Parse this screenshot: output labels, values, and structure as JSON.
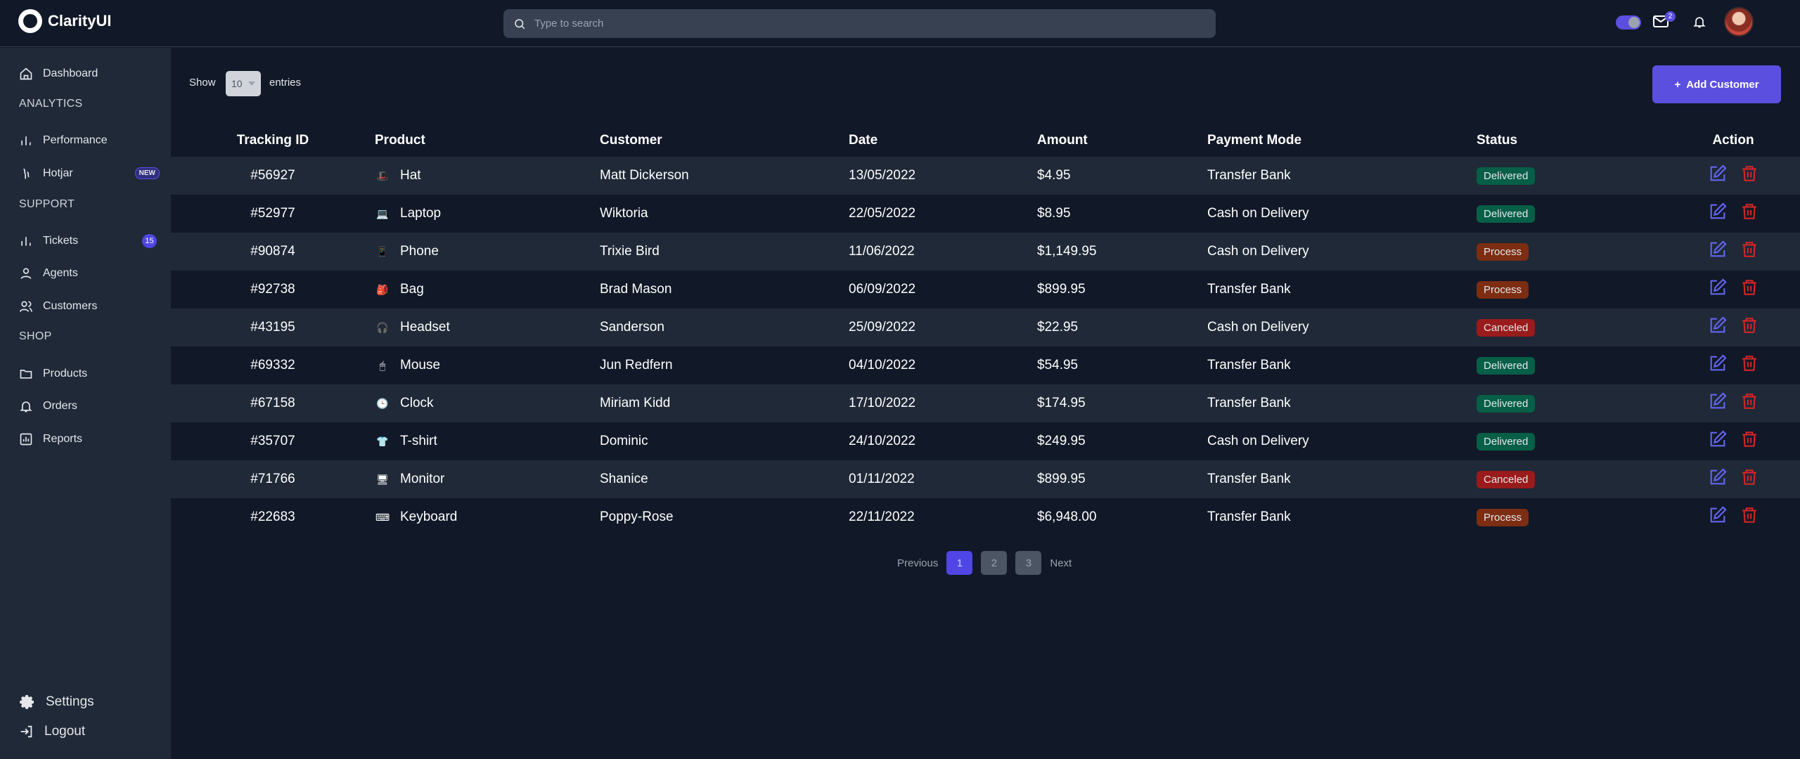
{
  "app": {
    "name": "ClarityUI"
  },
  "search": {
    "placeholder": "Type to search"
  },
  "header": {
    "mail_count": "2"
  },
  "sidebar": {
    "dashboard": "Dashboard",
    "sections": {
      "analytics": "ANALYTICS",
      "support": "SUPPORT",
      "shop": "SHOP"
    },
    "items": {
      "performance": "Performance",
      "hotjar": "Hotjar",
      "hotjar_badge": "NEW",
      "tickets": "Tickets",
      "tickets_count": "15",
      "agents": "Agents",
      "customers": "Customers",
      "products": "Products",
      "orders": "Orders",
      "reports": "Reports"
    },
    "settings": "Settings",
    "logout": "Logout"
  },
  "controls": {
    "show": "Show",
    "entries_value": "10",
    "entries": "entries",
    "add_button": "Add Customer",
    "add_icon": "+"
  },
  "table": {
    "headers": {
      "tracking_id": "Tracking ID",
      "product": "Product",
      "customer": "Customer",
      "date": "Date",
      "amount": "Amount",
      "payment_mode": "Payment Mode",
      "status": "Status",
      "action": "Action"
    },
    "rows": [
      {
        "id": "#56927",
        "product": "Hat",
        "icon": "hat-icon",
        "glyph": "🎩",
        "customer": "Matt Dickerson",
        "date": "13/05/2022",
        "amount": "$4.95",
        "payment": "Transfer Bank",
        "status": "Delivered",
        "status_type": "delivered"
      },
      {
        "id": "#52977",
        "product": "Laptop",
        "icon": "laptop-icon",
        "glyph": "💻",
        "customer": "Wiktoria",
        "date": "22/05/2022",
        "amount": "$8.95",
        "payment": "Cash on Delivery",
        "status": "Delivered",
        "status_type": "delivered"
      },
      {
        "id": "#90874",
        "product": "Phone",
        "icon": "phone-icon",
        "glyph": "📱",
        "customer": "Trixie Bird",
        "date": "11/06/2022",
        "amount": "$1,149.95",
        "payment": "Cash on Delivery",
        "status": "Process",
        "status_type": "process"
      },
      {
        "id": "#92738",
        "product": "Bag",
        "icon": "bag-icon",
        "glyph": "🎒",
        "customer": "Brad Mason",
        "date": "06/09/2022",
        "amount": "$899.95",
        "payment": "Transfer Bank",
        "status": "Process",
        "status_type": "process"
      },
      {
        "id": "#43195",
        "product": "Headset",
        "icon": "headset-icon",
        "glyph": "🎧",
        "customer": "Sanderson",
        "date": "25/09/2022",
        "amount": "$22.95",
        "payment": "Cash on Delivery",
        "status": "Canceled",
        "status_type": "canceled"
      },
      {
        "id": "#69332",
        "product": "Mouse",
        "icon": "mouse-icon",
        "glyph": "🖱",
        "customer": "Jun Redfern",
        "date": "04/10/2022",
        "amount": "$54.95",
        "payment": "Transfer Bank",
        "status": "Delivered",
        "status_type": "delivered"
      },
      {
        "id": "#67158",
        "product": "Clock",
        "icon": "clock-icon",
        "glyph": "🕒",
        "customer": "Miriam Kidd",
        "date": "17/10/2022",
        "amount": "$174.95",
        "payment": "Transfer Bank",
        "status": "Delivered",
        "status_type": "delivered"
      },
      {
        "id": "#35707",
        "product": "T-shirt",
        "icon": "tshirt-icon",
        "glyph": "👕",
        "customer": "Dominic",
        "date": "24/10/2022",
        "amount": "$249.95",
        "payment": "Cash on Delivery",
        "status": "Delivered",
        "status_type": "delivered"
      },
      {
        "id": "#71766",
        "product": "Monitor",
        "icon": "monitor-icon",
        "glyph": "🖥",
        "customer": "Shanice",
        "date": "01/11/2022",
        "amount": "$899.95",
        "payment": "Transfer Bank",
        "status": "Canceled",
        "status_type": "canceled"
      },
      {
        "id": "#22683",
        "product": "Keyboard",
        "icon": "keyboard-icon",
        "glyph": "⌨",
        "customer": "Poppy-Rose",
        "date": "22/11/2022",
        "amount": "$6,948.00",
        "payment": "Transfer Bank",
        "status": "Process",
        "status_type": "process"
      }
    ]
  },
  "pagination": {
    "previous": "Previous",
    "pages": [
      "1",
      "2",
      "3"
    ],
    "active": "1",
    "next": "Next"
  },
  "colors": {
    "background": "#111827",
    "sidebar": "#1f2937",
    "accent": "#5b4fe0",
    "delivered": "#065f46",
    "process": "#7c2d12",
    "canceled": "#991b1b",
    "edit_icon": "#6366f1",
    "delete_icon": "#dc2626"
  }
}
